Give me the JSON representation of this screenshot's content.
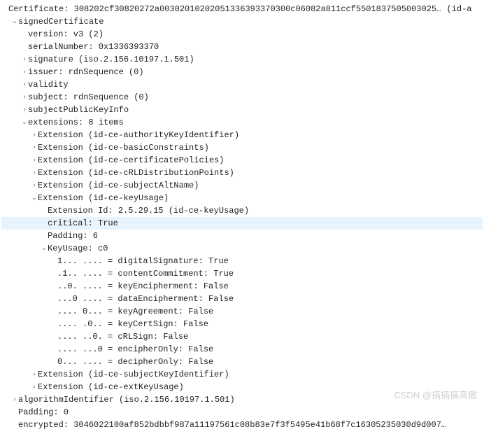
{
  "cert": {
    "label": "Certificate: 308202cf30820272a00302010202051336393370300c06082a811ccf5501837505003025… (id-a",
    "signed": {
      "label": "signedCertificate",
      "version": "version: v3 (2)",
      "serial": "serialNumber: 0x1336393370",
      "signature": "signature (iso.2.156.10197.1.501)",
      "issuer": "issuer: rdnSequence (0)",
      "validity": "validity",
      "subject": "subject: rdnSequence (0)",
      "spki": "subjectPublicKeyInfo",
      "extensions": {
        "label": "extensions: 8 items",
        "e0": "Extension (id-ce-authorityKeyIdentifier)",
        "e1": "Extension (id-ce-basicConstraints)",
        "e2": "Extension (id-ce-certificatePolicies)",
        "e3": "Extension (id-ce-cRLDistributionPoints)",
        "e4": "Extension (id-ce-subjectAltName)",
        "e5": {
          "label": "Extension (id-ce-keyUsage)",
          "extid": "Extension Id: 2.5.29.15 (id-ce-keyUsage)",
          "critical": "critical: True",
          "padding": "Padding: 6",
          "ku": {
            "label": "KeyUsage: c0",
            "b0": "1... .... = digitalSignature: True",
            "b1": ".1.. .... = contentCommitment: True",
            "b2": "..0. .... = keyEncipherment: False",
            "b3": "...0 .... = dataEncipherment: False",
            "b4": ".... 0... = keyAgreement: False",
            "b5": ".... .0.. = keyCertSign: False",
            "b6": ".... ..0. = cRLSign: False",
            "b7": ".... ...0 = encipherOnly: False",
            "b8": "0... .... = decipherOnly: False"
          }
        },
        "e6": "Extension (id-ce-subjectKeyIdentifier)",
        "e7": "Extension (id-ce-extKeyUsage)"
      }
    },
    "algo": "algorithmIdentifier (iso.2.156.10197.1.501)",
    "paddingOuter": "Padding: 0",
    "encrypted": "encrypted: 3046022100af852bdbbf987a11197561c08b83e7f3f5495e41b68f7c16305235030d9d007…"
  },
  "watermark": "CSDN @搞搞搞高傲"
}
